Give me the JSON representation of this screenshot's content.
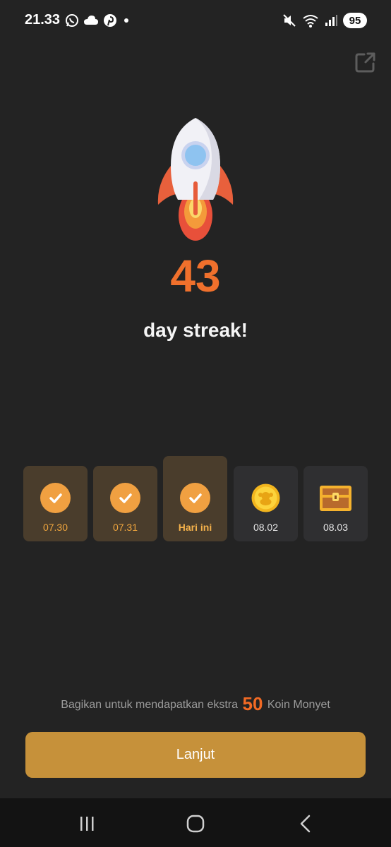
{
  "status_bar": {
    "time": "21.33",
    "left_icons": [
      "whatsapp-icon",
      "cloud-icon",
      "pinterest-icon",
      "dot-icon"
    ],
    "right_icons": [
      "mute-icon",
      "wifi-icon",
      "signal-icon"
    ],
    "battery": "95"
  },
  "streak": {
    "count": "43",
    "label": "day streak!"
  },
  "days": [
    {
      "label": "07.30",
      "state": "done",
      "icon": "check-icon"
    },
    {
      "label": "07.31",
      "state": "done",
      "icon": "check-icon"
    },
    {
      "label": "Hari ini",
      "state": "today",
      "icon": "check-icon"
    },
    {
      "label": "08.02",
      "state": "future",
      "icon": "coin-icon"
    },
    {
      "label": "08.03",
      "state": "future",
      "icon": "treasure-chest-icon"
    }
  ],
  "share_hint": {
    "prefix": "Bagikan untuk mendapatkan ekstra",
    "amount": "50",
    "suffix": "Koin Monyet"
  },
  "continue_label": "Lanjut",
  "colors": {
    "background": "#232323",
    "accent_orange": "#f0702c",
    "button": "#c6913a",
    "check": "#f0a041"
  }
}
